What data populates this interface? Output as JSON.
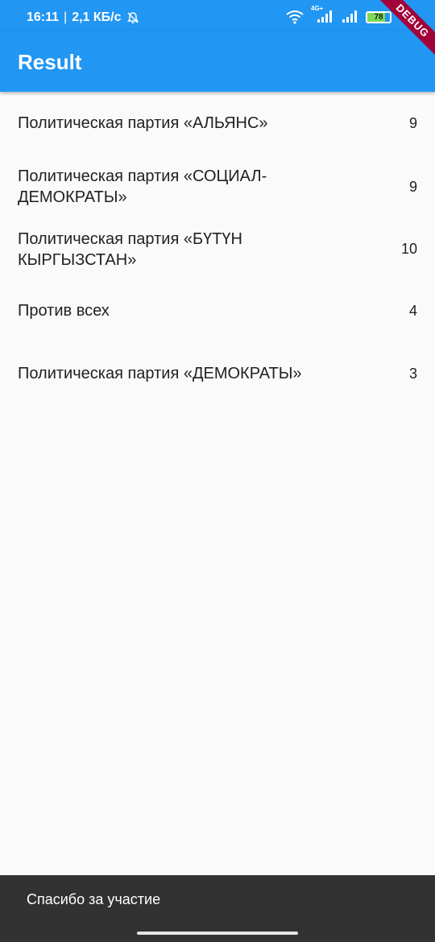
{
  "status_bar": {
    "time": "16:11",
    "separator": "|",
    "speed": "2,1 КБ/с",
    "network_type": "4G+",
    "battery_level": "78",
    "icons": [
      "mute-bell-icon",
      "wifi-icon",
      "signal-icon",
      "signal-icon",
      "battery-icon"
    ]
  },
  "app_bar": {
    "title": "Result"
  },
  "debug_banner": {
    "label": "DEBUG"
  },
  "results": [
    {
      "label": "Политическая партия «АЛЬЯНС»",
      "count": "9"
    },
    {
      "label": "Политическая партия «СОЦИАЛ-ДЕМОКРАТЫ»",
      "count": "9"
    },
    {
      "label": "Политическая партия «БҮТҮН КЫРГЫЗСТАН»",
      "count": "10"
    },
    {
      "label": "Против всех",
      "count": "4"
    },
    {
      "label": "Политическая партия «ДЕМОКРАТЫ»",
      "count": "3"
    }
  ],
  "snackbar": {
    "message": "Спасибо за участие"
  },
  "colors": {
    "primary": "#2196f3",
    "background": "#fafafa",
    "snackbar": "#323232",
    "debug_banner": "#a2003a",
    "battery_fill": "#7ed957"
  }
}
